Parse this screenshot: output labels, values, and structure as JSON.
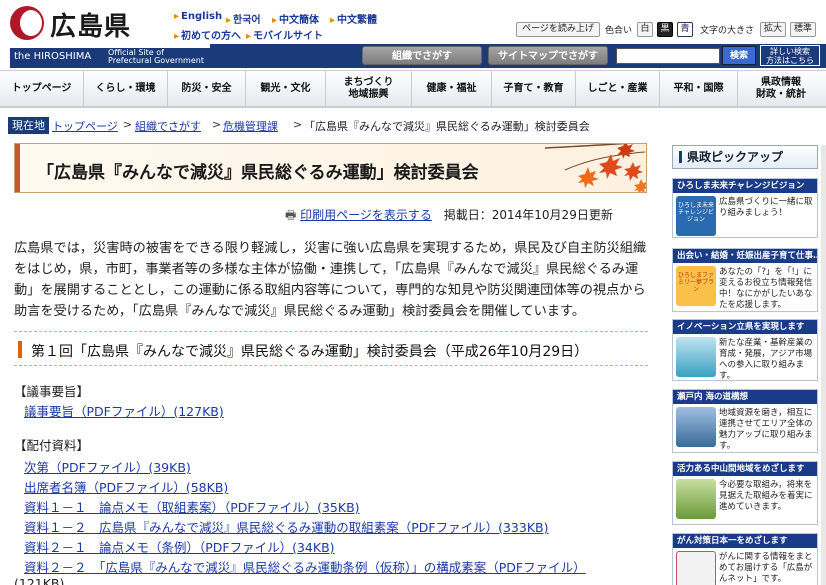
{
  "header": {
    "logo_text": "広島県",
    "logo_en": "the HIROSHIMA",
    "official_line1": "Official Site of",
    "official_line2": "Prefectural Government",
    "lang_links": [
      "English",
      "한국어",
      "中文簡体",
      "中文繁體"
    ],
    "guide_links": [
      "初めての方へ",
      "モバイルサイト"
    ],
    "read_button": "ページを読み上げ",
    "color_label": "色合い",
    "color_buttons": [
      "白",
      "黒",
      "青"
    ],
    "text_size_label": "文字の大きさ",
    "size_buttons": [
      "拡大",
      "標準"
    ],
    "org_search": "組織でさがす",
    "sitemap_search": "サイトマップでさがす",
    "search_button": "検索",
    "detail_search": "詳しい検索\n方法はこちら"
  },
  "nav": [
    "トップページ",
    "くらし・環境",
    "防災・安全",
    "観光・文化",
    "まちづくり\n地域振興",
    "健康・福祉",
    "子育て・教育",
    "しごと・産業",
    "平和・国際",
    "県政情報\n財政・統計"
  ],
  "breadcrumb": {
    "here": "現在地",
    "links": [
      "トップページ",
      "組織でさがす",
      "危機管理課"
    ],
    "current": "「広島県『みんなで減災』県民総ぐるみ運動」検討委員会"
  },
  "page_title": "「広島県『みんなで減災』県民総ぐるみ運動」検討委員会",
  "print_link": "印刷用ページを表示する",
  "published": "掲載日：2014年10月29日更新",
  "intro": "広島県では，災害時の被害をできる限り軽減し，災害に強い広島県を実現するため，県民及び自主防災組織をはじめ，県，市町，事業者等の多様な主体が協働・連携して，「広島県『みんなで減災』県民総ぐるみ運動」を展開することとし，この運動に係る取組内容等について，専門的な知見や防災関連団体等の視点から助言を受けるため，「広島県『みんなで減災』県民総ぐるみ運動」検討委員会を開催しています。",
  "meeting_heading": "第１回「広島県『みんなで減災』県民総ぐるみ運動」検討委員会（平成26年10月29日）",
  "summary_heading": "【議事要旨】",
  "summary_link": "議事要旨（PDFファイル）(127KB)",
  "materials_heading": "【配付資料】",
  "materials": [
    "次第（PDFファイル）(39KB)",
    "出席者名簿（PDFファイル）(58KB)",
    "資料１－１　論点メモ（取組素案）（PDFファイル）(35KB)",
    "資料１－２　広島県『みんなで減災』県民総ぐるみ運動の取組素案（PDFファイル）(333KB)",
    "資料２－１　論点メモ（条例）（PDFファイル）(34KB)",
    "資料２－２　「広島県『みんなで減災』県民総ぐるみ運動条例（仮称）」の構成素案（PDFファイル）"
  ],
  "materials_tail": "(121KB)",
  "right_column": {
    "heading": "県政ピックアップ",
    "picks": [
      {
        "title": "ひろしま未来チャレンジビジョン",
        "text": "ひろしま未来チャレンジビジョン",
        "desc": "広島県づくりに一緒に取り組みましょう！",
        "color": "#2a6ab0"
      },
      {
        "title": "出会い・結婚・妊娠出産子育て仕事…",
        "text": "ひろしまファミリー夢プラン",
        "desc": "あなたの「?」を「!」に変えるお役立ち情報発信中！なにかがしたいあなたを応援します。",
        "color": "#e87a20"
      },
      {
        "title": "イノベーション立県を実現します",
        "text": "",
        "desc": "新たな産業・基幹産業の育成・発展，アジア市場への参入に取り組みます。",
        "color": "#3aa0c0"
      },
      {
        "title": "瀬戸内 海の道構想",
        "text": "",
        "desc": "地域資源を磨き，相互に連携させてエリア全体の魅力アップに取り組みます。",
        "color": "#5a8ab8"
      },
      {
        "title": "活力ある中山間地域をめざします",
        "text": "",
        "desc": "今必要な取組み，将来を見据えた取組みを着実に進めていきます。",
        "color": "#7ab040"
      },
      {
        "title": "がん対策日本一をめざします",
        "text": "",
        "desc": "がんに関する情報をまとめてお届けする「広島がんネット」です。",
        "color": "#d04a6a"
      }
    ]
  },
  "colors": {
    "brand_navy": "#1a3a7a",
    "brand_red": "#b0182a",
    "accent_orange": "#e06010",
    "link": "#1a3aaa"
  }
}
